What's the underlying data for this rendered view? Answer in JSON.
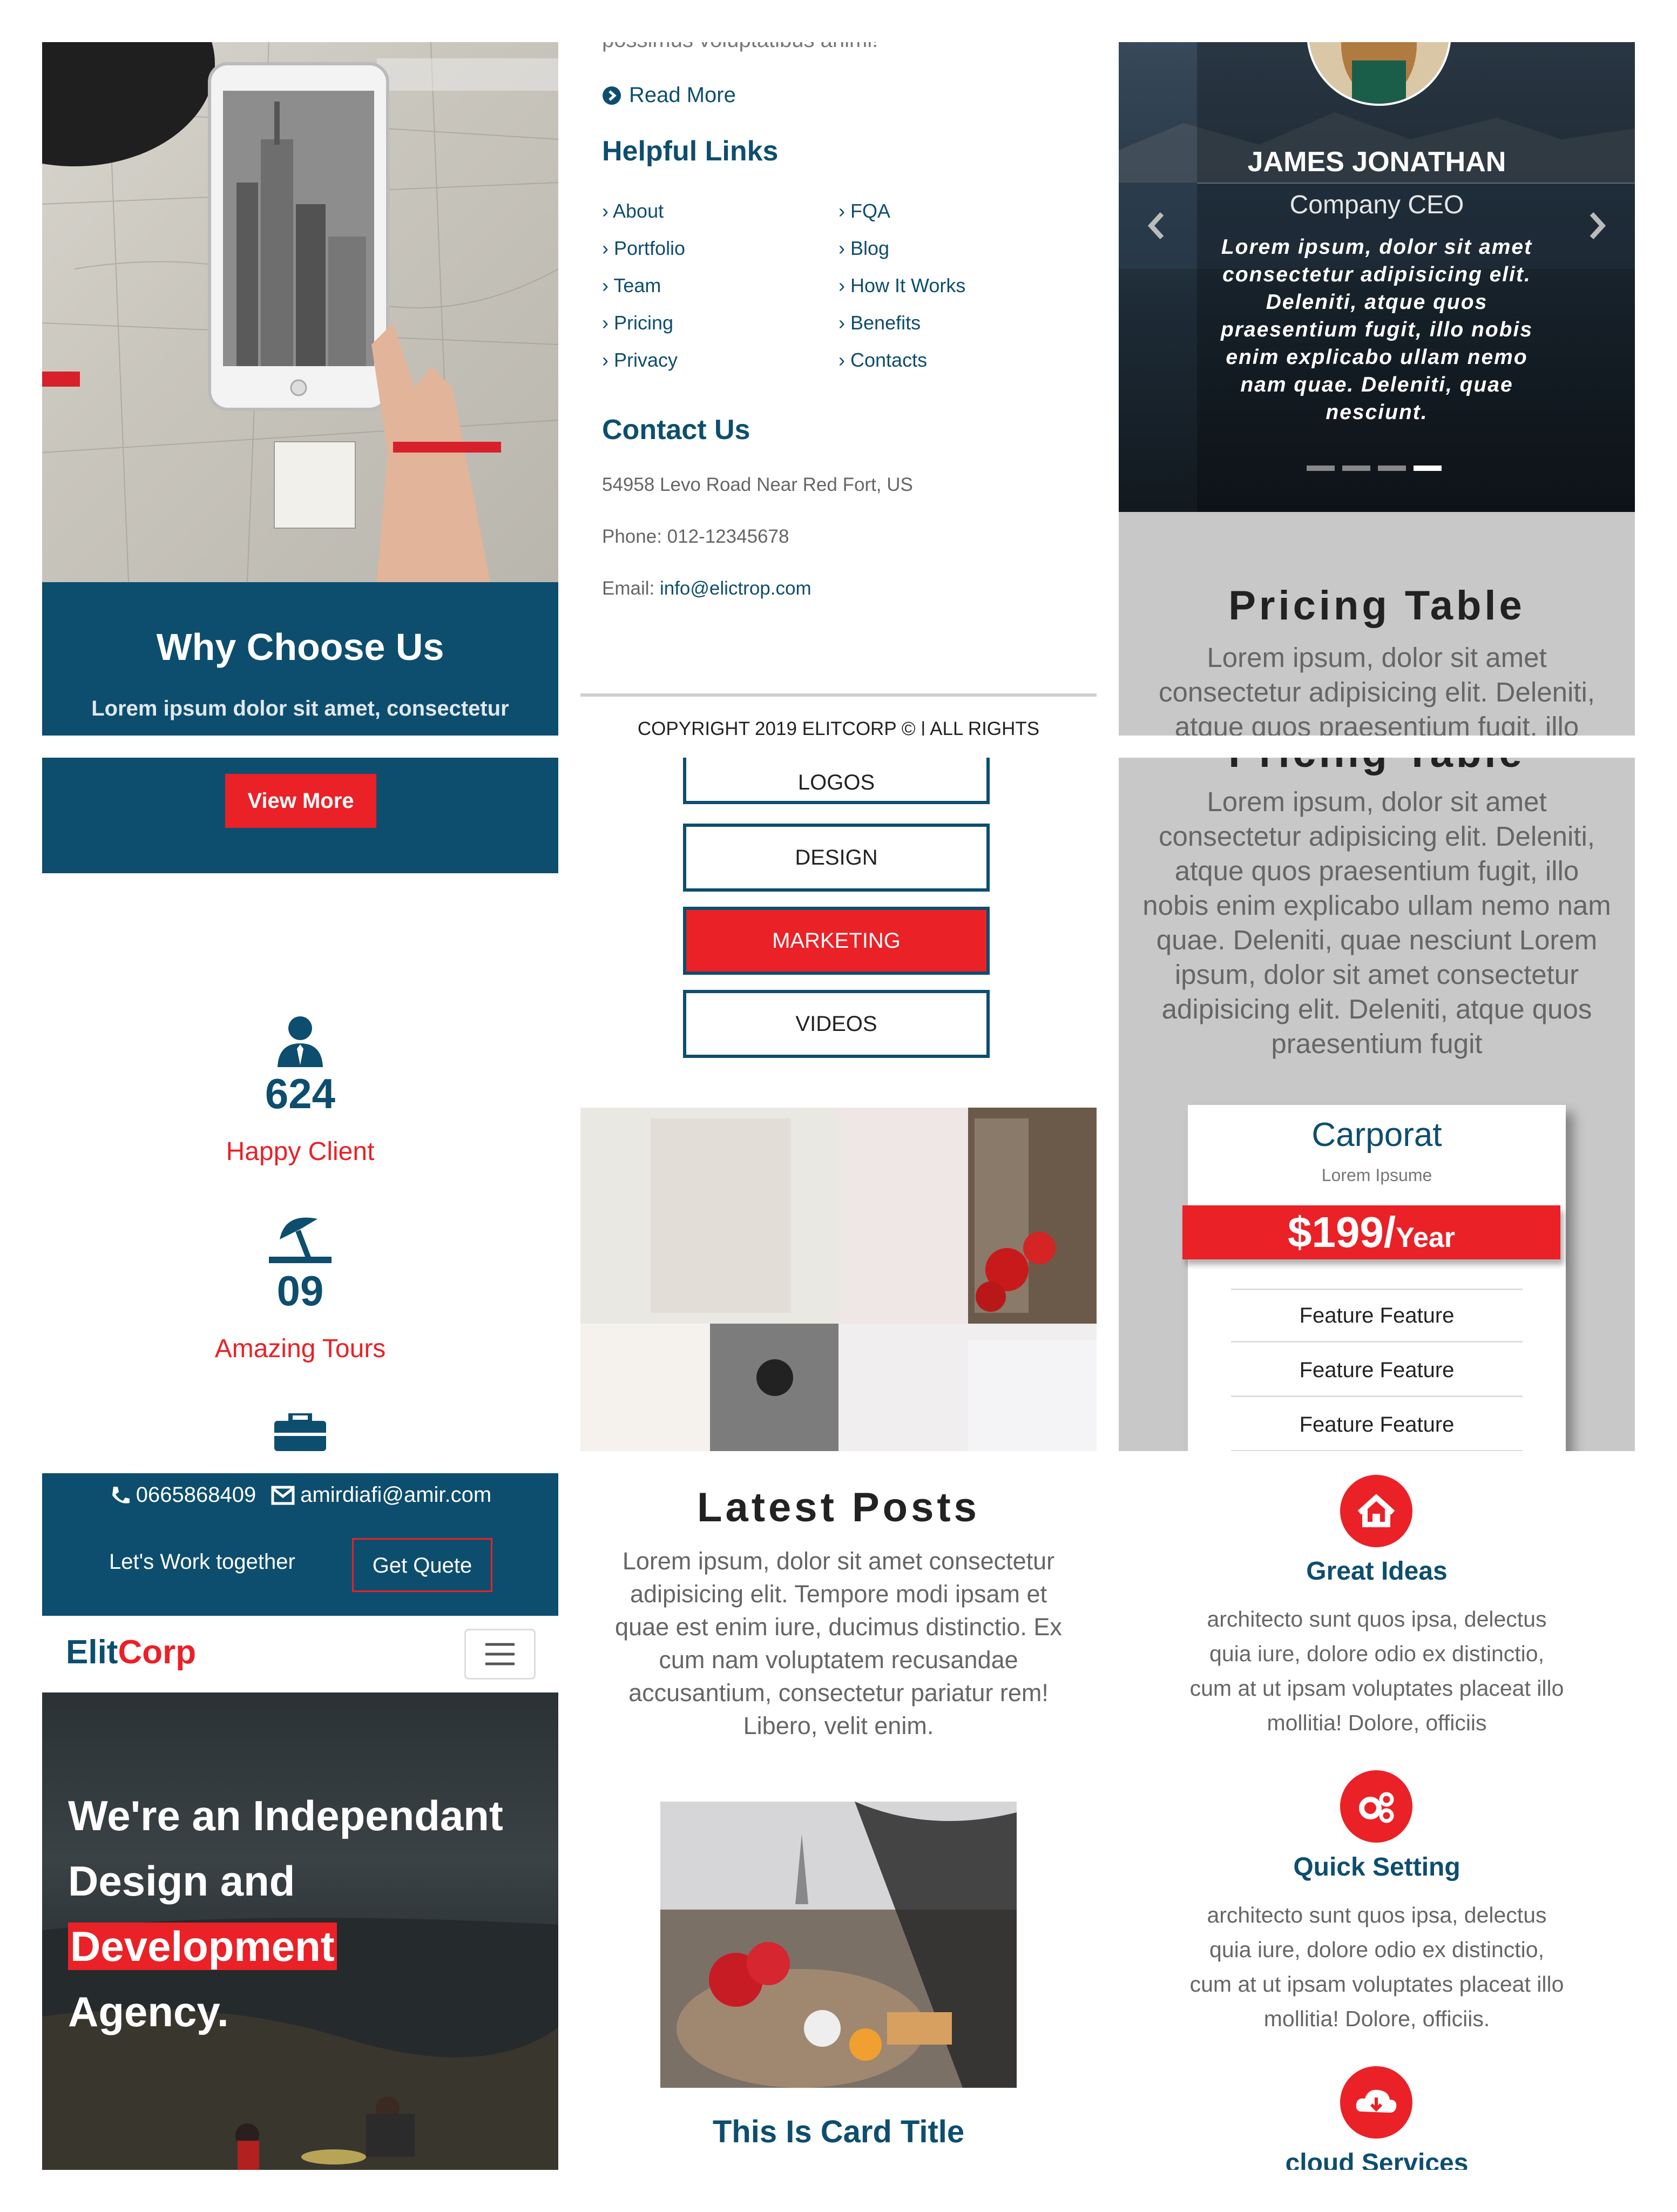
{
  "colors": {
    "navy": "#0d4e6e",
    "red": "#ea2127",
    "grey": "#c8c8c8",
    "text": "#555555"
  },
  "p1": {
    "title": "Why Choose Us",
    "subtitle": "Lorem ipsum dolor sit amet, consectetur"
  },
  "p2": {
    "cut_text": "possimus voluptatibus animi!",
    "read_more": "Read More",
    "links_title": "Helpful Links",
    "links_left": [
      "About",
      "Portfolio",
      "Team",
      "Pricing",
      "Privacy"
    ],
    "links_right": [
      "FQA",
      "Blog",
      "How It Works",
      "Benefits",
      "Contacts"
    ],
    "contact_title": "Contact Us",
    "address": "54958 Levo Road Near Red Fort, US",
    "phone": "Phone: 012-12345678",
    "email_label": "Email: ",
    "email": "info@elictrop.com",
    "copyright": "COPYRIGHT 2019 ELITCORP © | ALL RIGHTS"
  },
  "p3": {
    "name": "JAMES JONATHAN",
    "role": "Company CEO",
    "quote": "Lorem ipsum, dolor sit amet consectetur adipisicing elit. Deleniti, atque quos praesentium fugit, illo nobis enim explicabo ullam nemo nam quae. Deleniti, quae nesciunt.",
    "pricing_title": "Pricing Table",
    "pricing_text": "Lorem ipsum, dolor sit amet consectetur adipisicing elit. Deleniti, atque quos praesentium fugit, illo"
  },
  "p4": {
    "button": "View More"
  },
  "p5": {
    "buttons": [
      "LOGOS",
      "DESIGN",
      "MARKETING",
      "VIDEOS"
    ],
    "active": "MARKETING"
  },
  "p6": {
    "cut_title": "Pricing Table",
    "text": "Lorem ipsum, dolor sit amet consectetur adipisicing elit. Deleniti, atque quos praesentium fugit, illo nobis enim explicabo ullam nemo nam quae. Deleniti, quae nesciunt Lorem ipsum, dolor sit amet consectetur adipisicing elit. Deleniti, atque quos praesentium fugit",
    "card_title": "Carporat",
    "card_sub": "Lorem Ipsume",
    "price": "$199/",
    "price_unit": "Year",
    "features": [
      "Feature Feature",
      "Feature Feature",
      "Feature Feature"
    ]
  },
  "p7": {
    "stats": [
      {
        "icon": "user-tie-icon",
        "number": "624",
        "label": "Happy Client"
      },
      {
        "icon": "umbrella-beach-icon",
        "number": "09",
        "label": "Amazing Tours"
      }
    ]
  },
  "p8": {
    "phone": "0665868409",
    "email": "amirdiafi@amir.com",
    "work": "Let's Work together",
    "quote_btn": "Get Quete",
    "brand_a": "Elit",
    "brand_b": "Corp",
    "hero_line1": "We're an Independant",
    "hero_line2": "Design and ",
    "hero_highlight": "Development",
    "hero_line3": "Agency."
  },
  "p9": {
    "title": "Latest Posts",
    "text": "Lorem ipsum, dolor sit amet consectetur adipisicing elit. Tempore modi ipsam et quae est enim iure, ducimus distinctio. Ex cum nam voluptatem recusandae accusantium, consectetur pariatur rem! Libero, velit enim.",
    "card_title": "This Is Card Title"
  },
  "p10": {
    "services": [
      {
        "icon": "home-icon",
        "title": "Great Ideas",
        "text": "architecto sunt quos ipsa, delectus quia iure, dolore odio ex distinctio, cum at ut ipsam voluptates placeat illo mollitia! Dolore, officiis"
      },
      {
        "icon": "cogs-icon",
        "title": "Quick Setting",
        "text": "architecto sunt quos ipsa, delectus quia iure, dolore odio ex distinctio, cum at ut ipsam voluptates placeat illo mollitia! Dolore, officiis."
      },
      {
        "icon": "cloud-download-icon",
        "title": "cloud Services",
        "text": ""
      }
    ]
  }
}
